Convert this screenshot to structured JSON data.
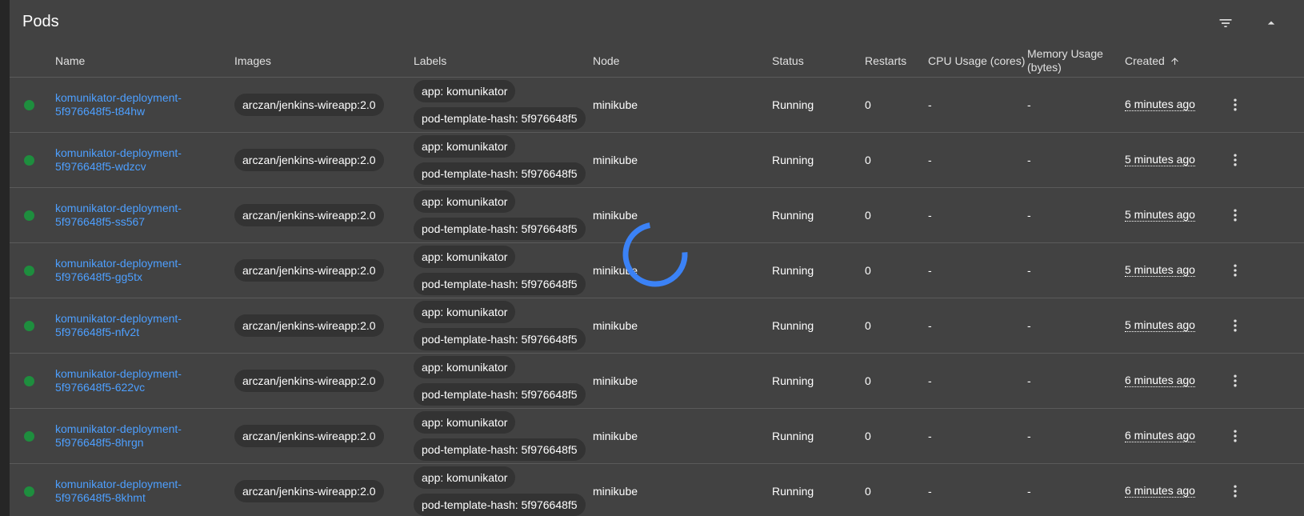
{
  "card": {
    "title": "Pods"
  },
  "header": {
    "filter_icon": "filter-list-icon",
    "collapse_icon": "arrow-drop-up-icon"
  },
  "columns": {
    "name": "Name",
    "images": "Images",
    "labels": "Labels",
    "node": "Node",
    "status": "Status",
    "restarts": "Restarts",
    "cpu": "CPU Usage (cores)",
    "memory_line1": "Memory Usage",
    "memory_line2": "(bytes)",
    "created": "Created",
    "created_sort_icon": "arrow-upward-icon"
  },
  "colors": {
    "status_running": "#1e8e3e",
    "link": "#4d9fff",
    "spinner": "#3b82f6"
  },
  "rows": [
    {
      "name_line1": "komunikator-deployment-",
      "name_line2": "5f976648f5-t84hw",
      "image": "arczan/jenkins-wireapp:2.0",
      "label1": "app: komunikator",
      "label2": "pod-template-hash: 5f976648f5",
      "node": "minikube",
      "status": "Running",
      "restarts": "0",
      "cpu": "-",
      "memory": "-",
      "created": "6 minutes ago"
    },
    {
      "name_line1": "komunikator-deployment-",
      "name_line2": "5f976648f5-wdzcv",
      "image": "arczan/jenkins-wireapp:2.0",
      "label1": "app: komunikator",
      "label2": "pod-template-hash: 5f976648f5",
      "node": "minikube",
      "status": "Running",
      "restarts": "0",
      "cpu": "-",
      "memory": "-",
      "created": "5 minutes ago"
    },
    {
      "name_line1": "komunikator-deployment-",
      "name_line2": "5f976648f5-ss567",
      "image": "arczan/jenkins-wireapp:2.0",
      "label1": "app: komunikator",
      "label2": "pod-template-hash: 5f976648f5",
      "node": "minikube",
      "status": "Running",
      "restarts": "0",
      "cpu": "-",
      "memory": "-",
      "created": "5 minutes ago"
    },
    {
      "name_line1": "komunikator-deployment-",
      "name_line2": "5f976648f5-gg5tx",
      "image": "arczan/jenkins-wireapp:2.0",
      "label1": "app: komunikator",
      "label2": "pod-template-hash: 5f976648f5",
      "node": "minikube",
      "status": "Running",
      "restarts": "0",
      "cpu": "-",
      "memory": "-",
      "created": "5 minutes ago"
    },
    {
      "name_line1": "komunikator-deployment-",
      "name_line2": "5f976648f5-nfv2t",
      "image": "arczan/jenkins-wireapp:2.0",
      "label1": "app: komunikator",
      "label2": "pod-template-hash: 5f976648f5",
      "node": "minikube",
      "status": "Running",
      "restarts": "0",
      "cpu": "-",
      "memory": "-",
      "created": "5 minutes ago"
    },
    {
      "name_line1": "komunikator-deployment-",
      "name_line2": "5f976648f5-622vc",
      "image": "arczan/jenkins-wireapp:2.0",
      "label1": "app: komunikator",
      "label2": "pod-template-hash: 5f976648f5",
      "node": "minikube",
      "status": "Running",
      "restarts": "0",
      "cpu": "-",
      "memory": "-",
      "created": "6 minutes ago"
    },
    {
      "name_line1": "komunikator-deployment-",
      "name_line2": "5f976648f5-8hrgn",
      "image": "arczan/jenkins-wireapp:2.0",
      "label1": "app: komunikator",
      "label2": "pod-template-hash: 5f976648f5",
      "node": "minikube",
      "status": "Running",
      "restarts": "0",
      "cpu": "-",
      "memory": "-",
      "created": "6 minutes ago"
    },
    {
      "name_line1": "komunikator-deployment-",
      "name_line2": "5f976648f5-8khmt",
      "image": "arczan/jenkins-wireapp:2.0",
      "label1": "app: komunikator",
      "label2": "pod-template-hash: 5f976648f5",
      "node": "minikube",
      "status": "Running",
      "restarts": "0",
      "cpu": "-",
      "memory": "-",
      "created": "6 minutes ago"
    }
  ]
}
